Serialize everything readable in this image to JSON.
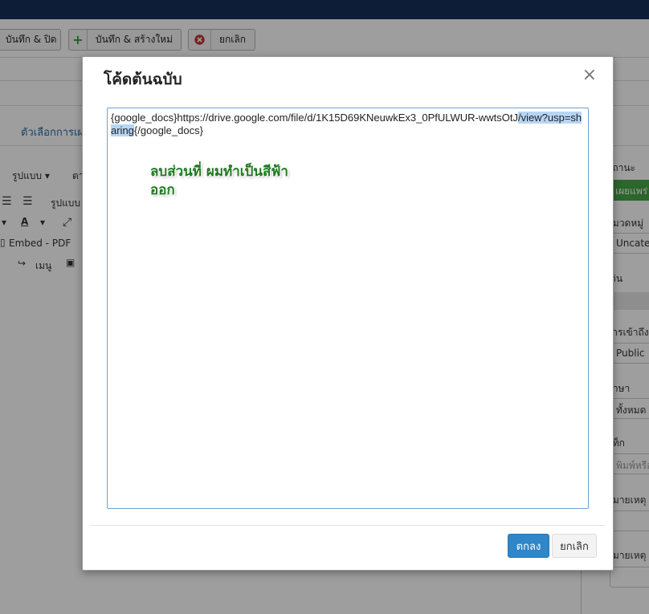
{
  "toolbar": {
    "save_close": "บันทึก & ปิด",
    "save_new": "บันทึก & สร้างใหม่",
    "save_new_icon": "plus-icon",
    "cancel": "ยกเลิก",
    "cancel_icon": "close-circle-icon"
  },
  "background": {
    "tab_label": "ตัวเลือกการเผย",
    "editor": {
      "format_menu": "รูปแบบ ▾",
      "format_menu2": "ตา",
      "format_label": "รูปแบบ",
      "embed_pdf": "Embed - PDF",
      "menu": "เมนู"
    },
    "side": {
      "status_label": "สถานะ",
      "status_value": "เผยแพร่",
      "category_label": "หมวดหมู่",
      "category_value": "Uncate",
      "featured_label": "เด่น",
      "access_label": "การเข้าถึง",
      "access_value": "Public",
      "language_label": "ภาษา",
      "language_value": "ทั้งหมด",
      "tags_label": "แท็ก",
      "tags_placeholder": "พิมพ์หรือ",
      "note_label": "หมายเหตุ",
      "note2_label": "หมายเหตุ"
    }
  },
  "modal": {
    "title": "โค้ดต้นฉบับ",
    "close_symbol": "×",
    "code_before": "{google_docs}https://drive.google.com/file/d/1K15D69KNeuwkEx3_0PfULWUR-wwtsOtJ",
    "code_selected": "/view?usp=sharing",
    "code_after": "{/google_docs}",
    "annotation": "ลบส่วนที่ ผมทำเป็นสีฟ้าออก",
    "ok_label": "ตกลง",
    "cancel_label": "ยกเลิก"
  },
  "colors": {
    "topbar": "#18305a",
    "ok_button": "#2f86c9",
    "selection": "#b6d5f5",
    "annotation": "#1f7a1f",
    "publish_green": "#46a546"
  }
}
